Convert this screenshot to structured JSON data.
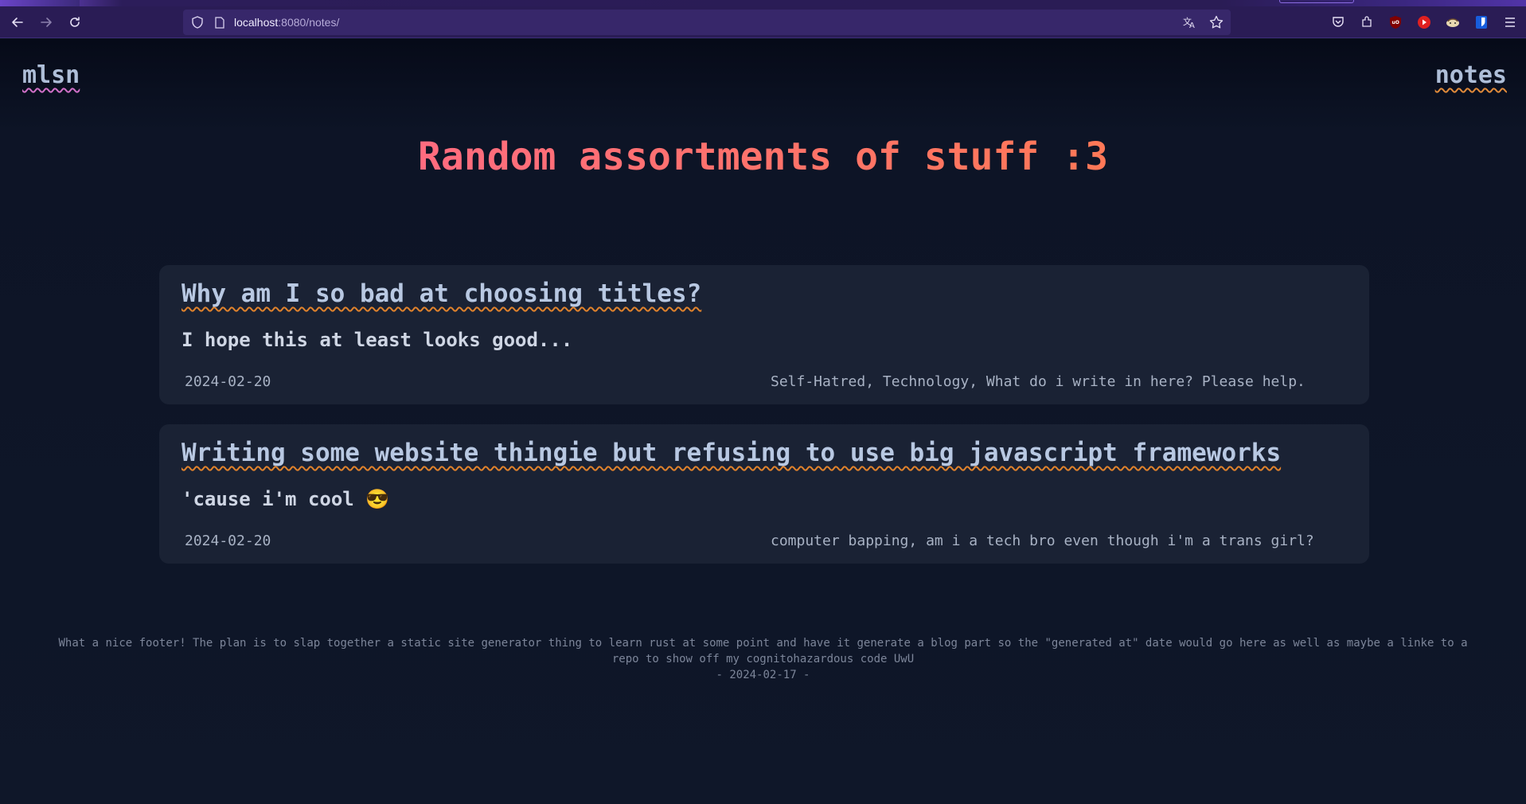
{
  "browser": {
    "url_host": "localhost",
    "url_rest": ":8080/notes/",
    "icons": [
      "back-arrow-icon",
      "forward-arrow-icon",
      "reload-icon",
      "shield-icon",
      "page-icon",
      "translate-icon",
      "star-icon",
      "pocket-icon",
      "extensions-icon",
      "ublock-icon",
      "youtube-icon",
      "extension-icon",
      "bitwarden-icon",
      "menu-icon"
    ]
  },
  "site": {
    "nav_left": "mlsn",
    "nav_right": "notes",
    "title": "Random assortments of stuff :3"
  },
  "posts": [
    {
      "title": "Why am I so bad at choosing titles?",
      "summary": "I hope this at least looks good...",
      "date": "2024-02-20",
      "tags": "Self-Hatred, Technology, What do i write in here? Please help."
    },
    {
      "title": "Writing some website thingie but refusing to use big javascript frameworks",
      "summary": "'cause i'm cool 😎",
      "date": "2024-02-20",
      "tags": "computer bapping, am i a tech bro even though i'm a trans girl?"
    }
  ],
  "footer": {
    "text": "What a nice footer! The plan is to slap together a static site generator thing to learn rust at some point and have it generate a blog part so the \"generated at\" date would go here as well as maybe a linke to a repo to show off my cognitohazardous code UwU",
    "date_line": "- 2024-02-17 -"
  },
  "colors": {
    "page_bg": "#0f1729",
    "card_bg": "#1a2234",
    "title_gradient_start": "#ff6a86",
    "title_gradient_end": "#ff7a50",
    "toolbar_bg": "#2a1c55"
  }
}
